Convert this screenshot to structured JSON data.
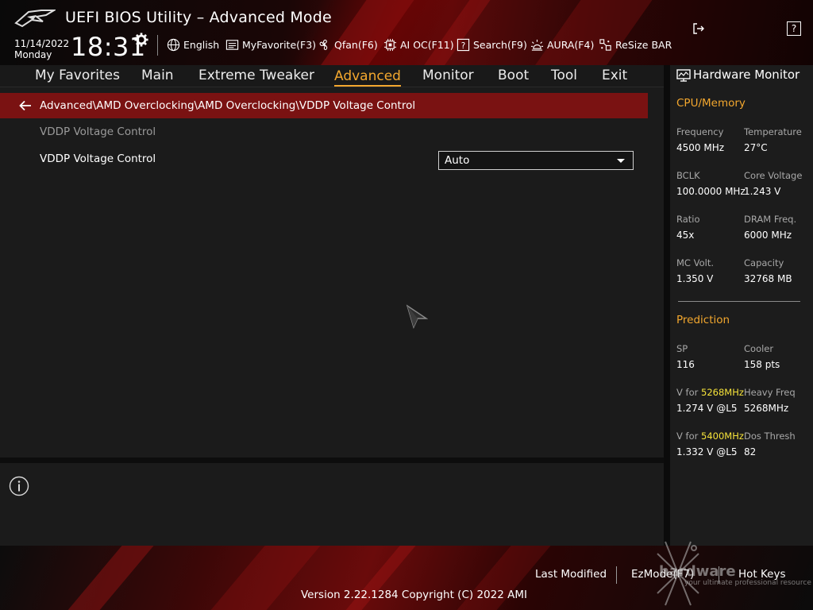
{
  "header": {
    "title": "UEFI BIOS Utility – Advanced Mode",
    "date": "11/14/2022",
    "weekday": "Monday",
    "time": "18:31",
    "toolbar": [
      {
        "label": "English",
        "icon": "globe-icon"
      },
      {
        "label": "MyFavorite(F3)",
        "icon": "favorite-icon"
      },
      {
        "label": "Qfan(F6)",
        "icon": "fan-icon"
      },
      {
        "label": "AI OC(F11)",
        "icon": "ai-chip-icon"
      },
      {
        "label": "Search(F9)",
        "icon": "search-icon"
      },
      {
        "label": "AURA(F4)",
        "icon": "aura-icon"
      },
      {
        "label": "ReSize BAR",
        "icon": "resize-bar-icon"
      }
    ]
  },
  "nav": {
    "tabs": [
      "My Favorites",
      "Main",
      "Extreme Tweaker",
      "Advanced",
      "Monitor",
      "Boot",
      "Tool",
      "Exit"
    ],
    "active": "Advanced"
  },
  "breadcrumb": "Advanced\\AMD Overclocking\\AMD Overclocking\\VDDP Voltage Control",
  "main": {
    "section_label": "VDDP Voltage Control",
    "setting_label": "VDDP Voltage Control",
    "setting_value": "Auto"
  },
  "hardware_monitor": {
    "title": "Hardware Monitor",
    "cpu_memory": {
      "heading": "CPU/Memory",
      "frequency_label": "Frequency",
      "frequency_value": "4500 MHz",
      "temperature_label": "Temperature",
      "temperature_value": "27°C",
      "bclk_label": "BCLK",
      "bclk_value": "100.0000 MHz",
      "core_voltage_label": "Core Voltage",
      "core_voltage_value": "1.243 V",
      "ratio_label": "Ratio",
      "ratio_value": "45x",
      "dram_freq_label": "DRAM Freq.",
      "dram_freq_value": "6000 MHz",
      "mc_volt_label": "MC Volt.",
      "mc_volt_value": "1.350 V",
      "capacity_label": "Capacity",
      "capacity_value": "32768 MB"
    },
    "prediction": {
      "heading": "Prediction",
      "sp_label": "SP",
      "sp_value": "116",
      "cooler_label": "Cooler",
      "cooler_value": "158 pts",
      "v_for_1_prefix": "V for ",
      "v_for_1_freq": "5268MHz",
      "v_for_1_value": "1.274 V @L5",
      "heavy_freq_label": "Heavy Freq",
      "heavy_freq_value": "5268MHz",
      "v_for_2_prefix": "V for ",
      "v_for_2_freq": "5400MHz",
      "v_for_2_value": "1.332 V @L5",
      "dos_thresh_label": "Dos Thresh",
      "dos_thresh_value": "82"
    }
  },
  "footer": {
    "last_modified": "Last Modified",
    "ezmode": "EzMode(F7)",
    "hot_keys": "Hot Keys",
    "hot_keys_key": "?",
    "version": "Version 2.22.1284 Copyright (C) 2022 AMI"
  },
  "watermark": {
    "brand": "hardware",
    "tagline": "your ultimate professional resource"
  },
  "colors": {
    "accent": "#f3a72e",
    "highlight": "#f6e33a",
    "breadcrumb_bg": "#7a1212",
    "panel_bg": "#1b1b1b"
  }
}
